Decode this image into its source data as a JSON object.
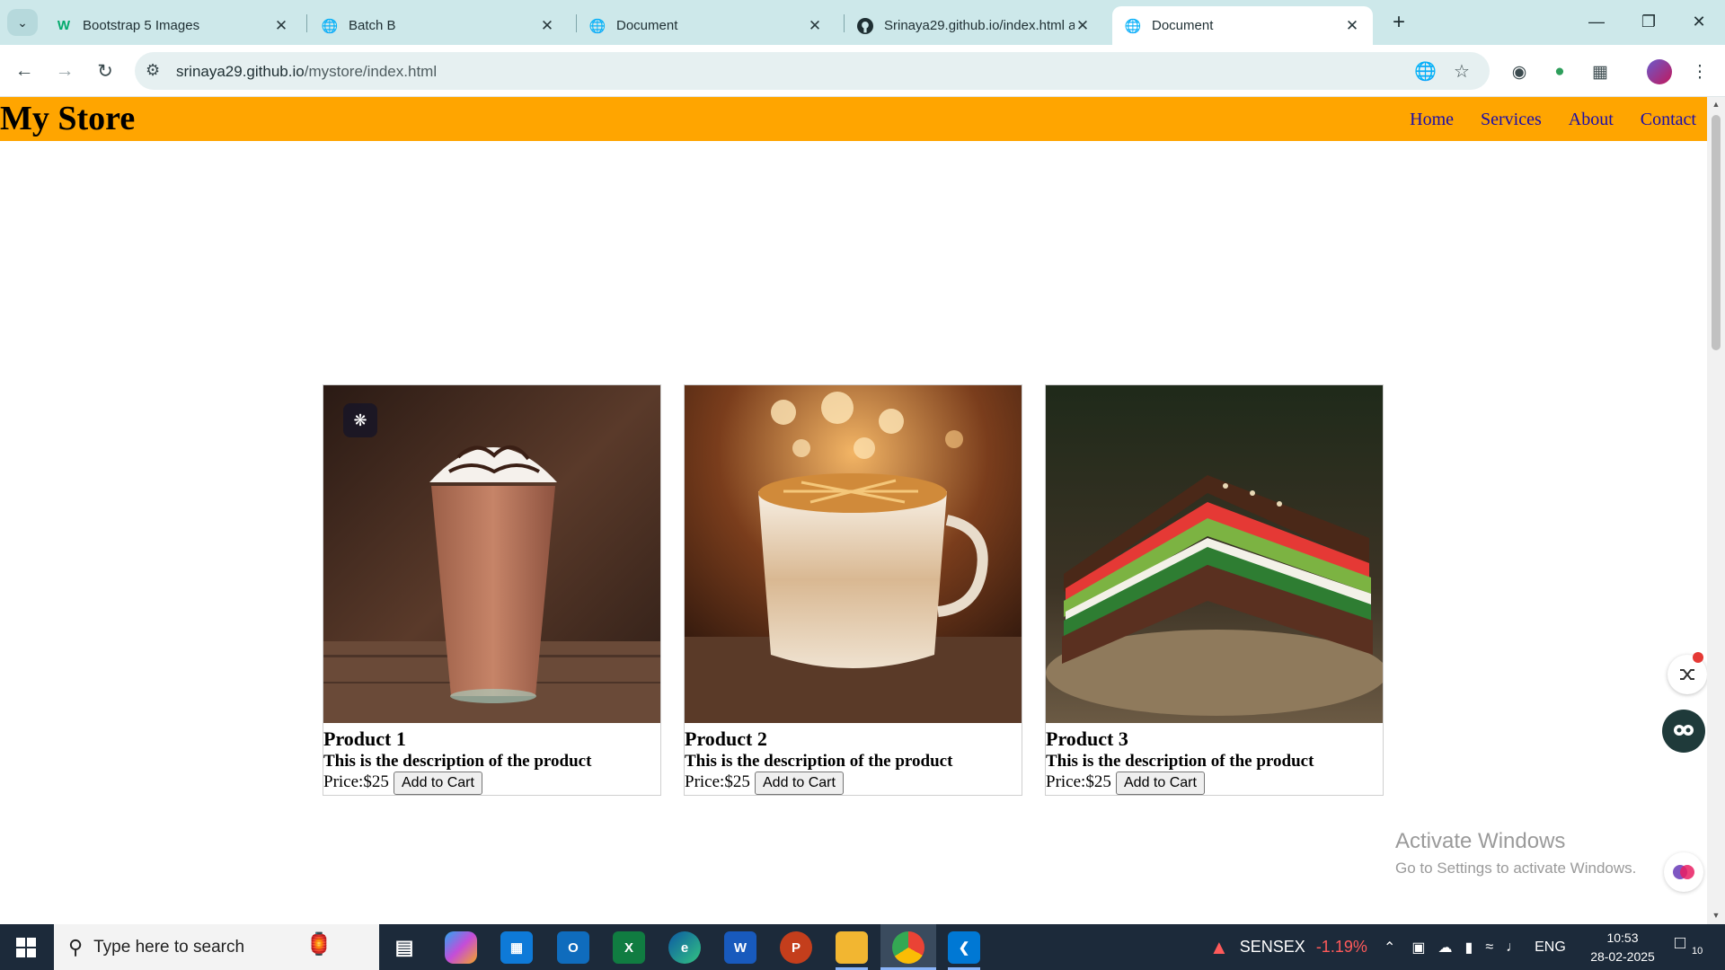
{
  "browser": {
    "tabs": [
      {
        "title": "Bootstrap 5 Images",
        "favicon": "w3schools-icon",
        "active": false
      },
      {
        "title": "Batch B",
        "favicon": "globe-icon",
        "active": false
      },
      {
        "title": "Document",
        "favicon": "globe-icon",
        "active": false
      },
      {
        "title": "Srinaya29.github.io/index.html a",
        "favicon": "github-icon",
        "active": false
      },
      {
        "title": "Document",
        "favicon": "globe-icon",
        "active": true
      }
    ],
    "url_host": "srinaya29.github.io",
    "url_path": "/mystore/index.html"
  },
  "page": {
    "brand": "My Store",
    "nav": [
      "Home",
      "Services",
      "About",
      "Contact"
    ],
    "products": [
      {
        "name": "Product 1",
        "description": "This is the description of the product",
        "price": "Price:$25",
        "button": "Add to Cart",
        "image": "frappuccino-drink"
      },
      {
        "name": "Product 2",
        "description": "This is the description of the product",
        "price": "Price:$25",
        "button": "Add to Cart",
        "image": "caramel-latte"
      },
      {
        "name": "Product 3",
        "description": "This is the description of the product",
        "price": "Price:$25",
        "button": "Add to Cart",
        "image": "sandwich"
      }
    ],
    "watermark": {
      "line1": "Activate Windows",
      "line2": "Go to Settings to activate Windows."
    },
    "colors": {
      "navbar": "#ffa500",
      "nav_link": "#1a0dab"
    }
  },
  "taskbar": {
    "search_placeholder": "Type here to search",
    "apps": [
      "task-view",
      "copilot",
      "microsoft-store",
      "outlook",
      "excel",
      "edge",
      "word",
      "powerpoint",
      "file-explorer",
      "chrome",
      "vscode"
    ],
    "sensex_label": "SENSEX",
    "sensex_change": "-1.19%",
    "language": "ENG",
    "time": "10:53",
    "date": "28-02-2025",
    "notification_count": "10"
  }
}
